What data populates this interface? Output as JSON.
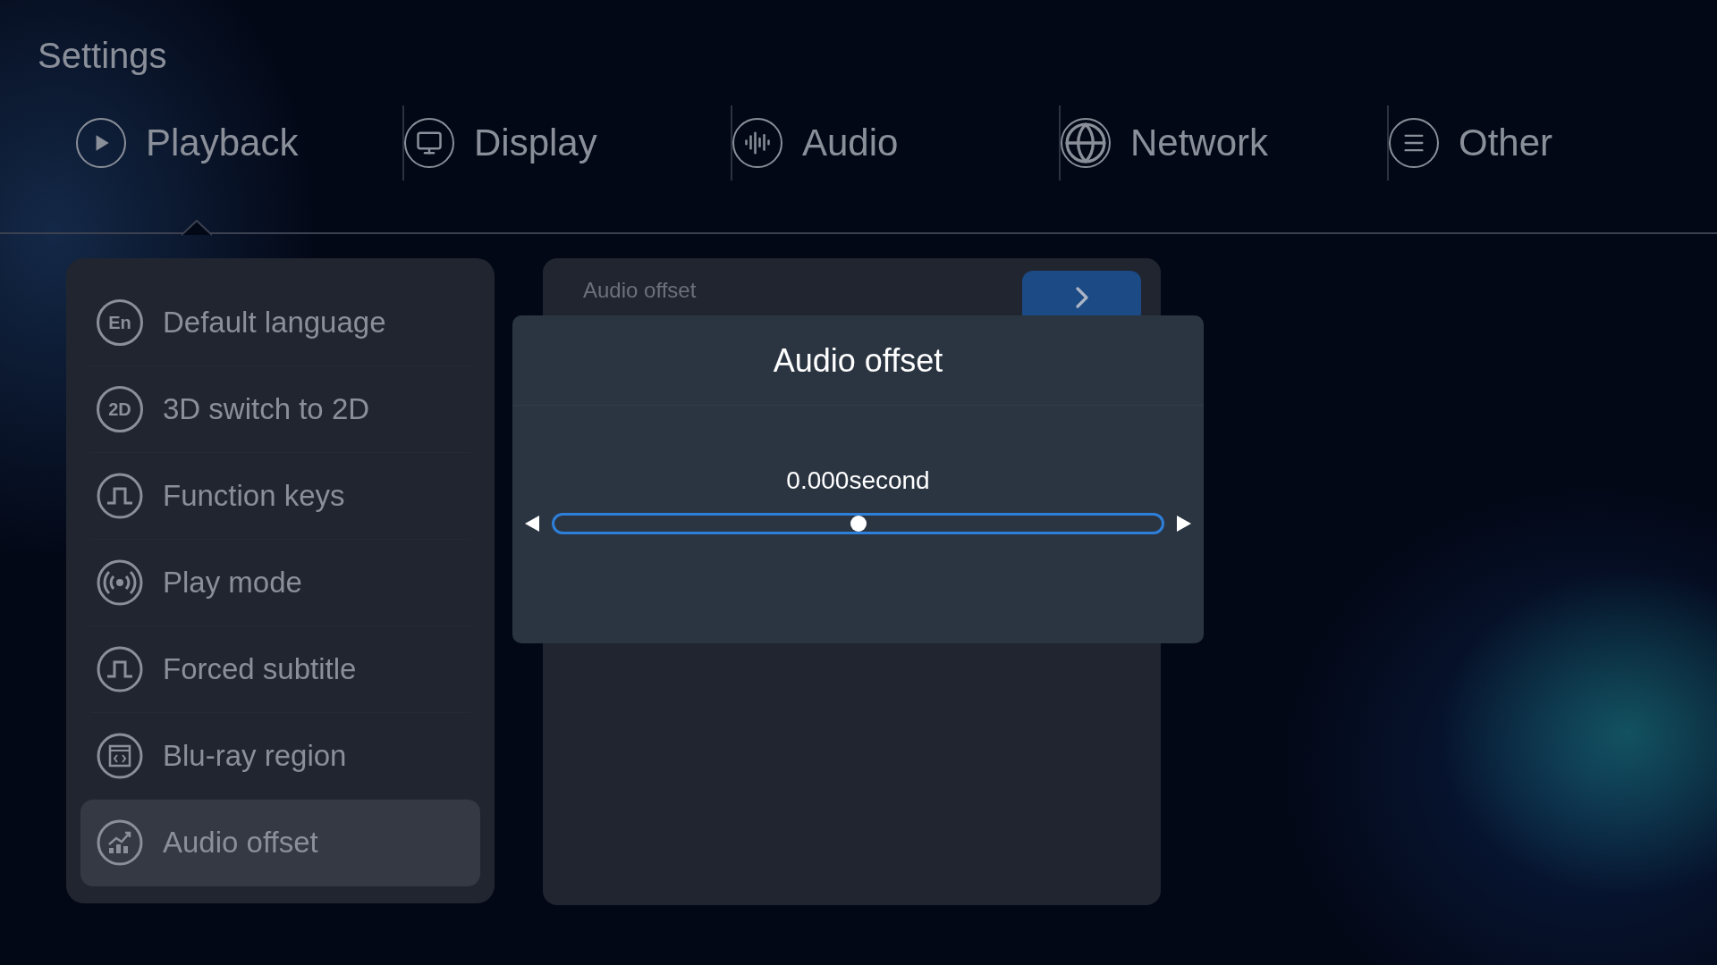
{
  "title": "Settings",
  "tabs": [
    {
      "label": "Playback",
      "selected": true
    },
    {
      "label": "Display",
      "selected": false
    },
    {
      "label": "Audio",
      "selected": false
    },
    {
      "label": "Network",
      "selected": false
    },
    {
      "label": "Other",
      "selected": false
    }
  ],
  "menu": [
    {
      "label": "Default language",
      "badge": "En",
      "selected": false
    },
    {
      "label": "3D switch to 2D",
      "badge": "2D",
      "selected": false
    },
    {
      "label": "Function keys",
      "selected": false
    },
    {
      "label": "Play mode",
      "selected": false
    },
    {
      "label": "Forced subtitle",
      "selected": false
    },
    {
      "label": "Blu-ray region",
      "selected": false
    },
    {
      "label": "Audio offset",
      "selected": true
    }
  ],
  "detail": {
    "title": "Audio offset"
  },
  "dialog": {
    "title": "Audio offset",
    "reading": "0.000second",
    "level": 0.5
  }
}
